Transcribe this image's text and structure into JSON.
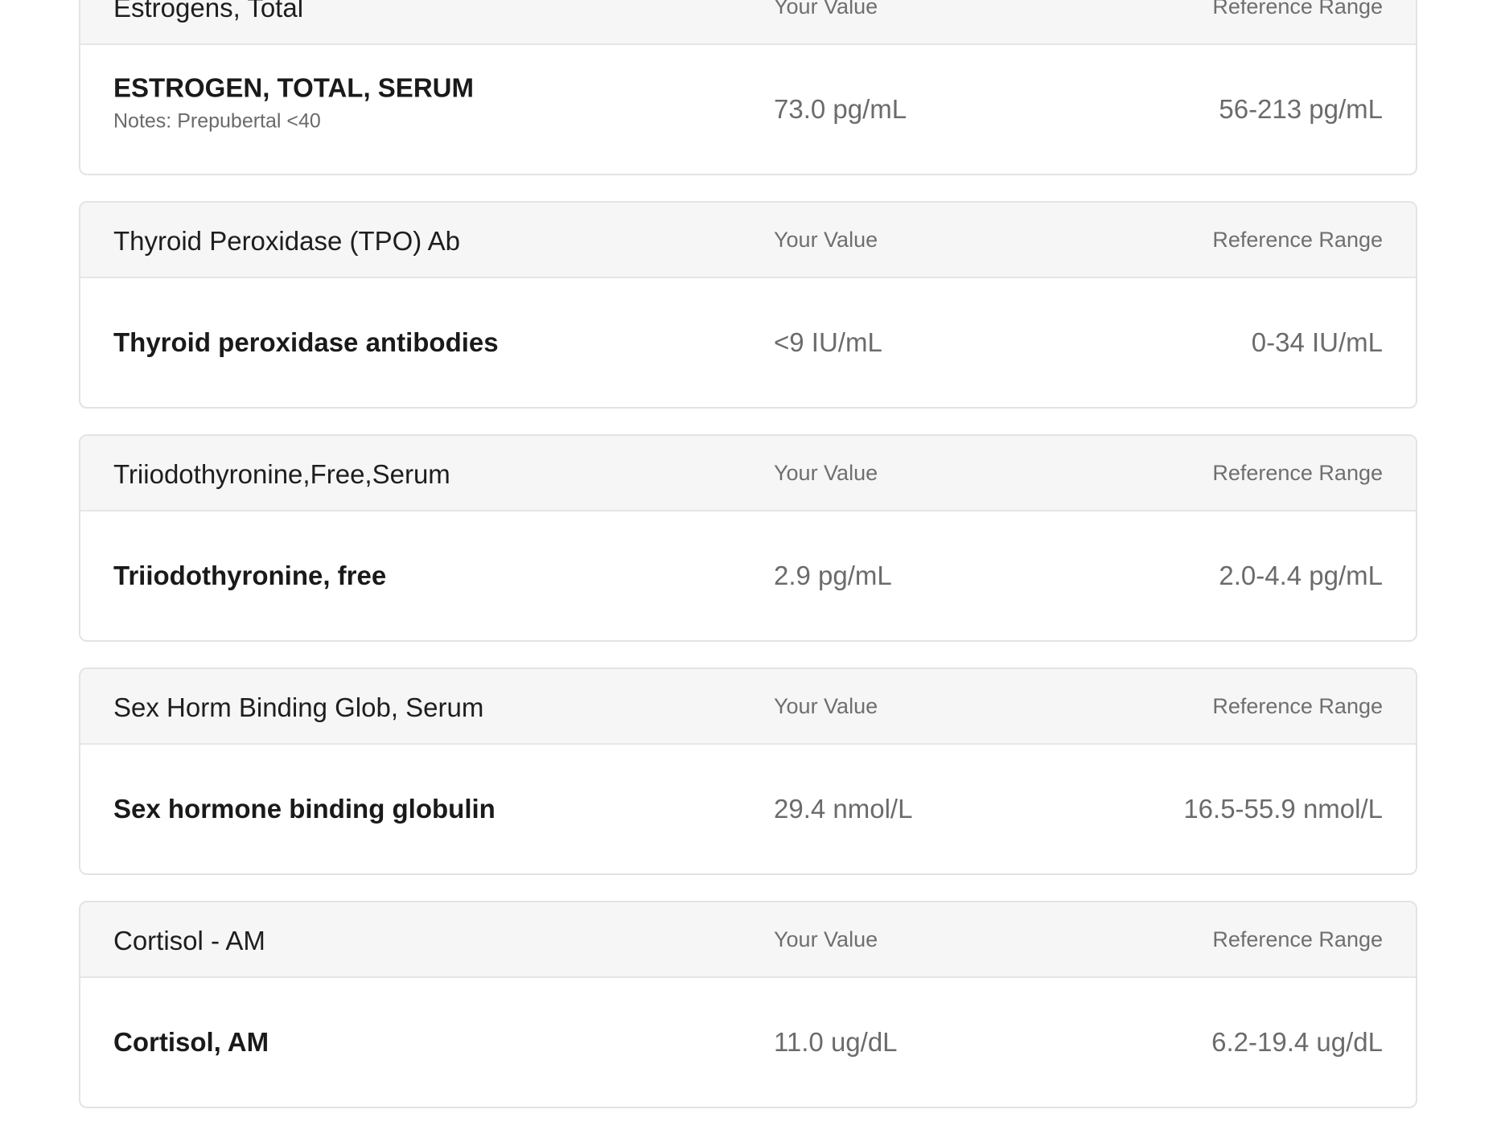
{
  "columns": {
    "value_label": "Your Value",
    "range_label": "Reference Range"
  },
  "panels": [
    {
      "title": "Estrogens, Total",
      "result_name": "ESTROGEN, TOTAL, SERUM",
      "note": "Notes: Prepubertal <40",
      "value": "73.0 pg/mL",
      "range": "56-213 pg/mL"
    },
    {
      "title": "Thyroid Peroxidase (TPO) Ab",
      "result_name": "Thyroid peroxidase antibodies",
      "value": "<9 IU/mL",
      "range": "0-34 IU/mL"
    },
    {
      "title": "Triiodothyronine,Free,Serum",
      "result_name": "Triiodothyronine, free",
      "value": "2.9 pg/mL",
      "range": "2.0-4.4 pg/mL"
    },
    {
      "title": "Sex Horm Binding Glob, Serum",
      "result_name": "Sex hormone binding globulin",
      "value": "29.4 nmol/L",
      "range": "16.5-55.9 nmol/L"
    },
    {
      "title": "Cortisol - AM",
      "result_name": "Cortisol, AM",
      "value": "11.0 ug/dL",
      "range": "6.2-19.4 ug/dL"
    }
  ]
}
